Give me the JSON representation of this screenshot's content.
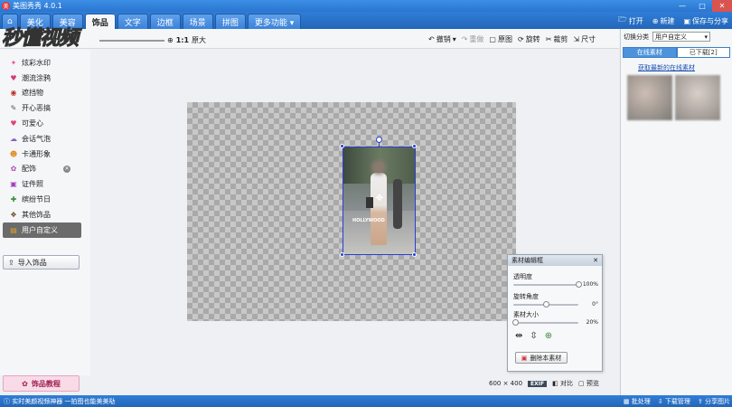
{
  "window": {
    "title": "美图秀秀 4.0.1",
    "controls": [
      "—",
      "□",
      "✕"
    ]
  },
  "menu": {
    "tabs": [
      "美化",
      "美容",
      "饰品",
      "文字",
      "边框",
      "场景",
      "拼图",
      "更多功能 ▾"
    ],
    "active": "饰品",
    "right": {
      "open": "打开",
      "new": "新建",
      "save": "保存与分享"
    }
  },
  "watermark": "秒懂视频",
  "toolbar": {
    "zoom_ratio": "1:1",
    "original_size": "原大",
    "undo": "撤销",
    "redo": "重做",
    "original": "原图",
    "rotate": "旋转",
    "crop": "裁剪",
    "size": "尺寸"
  },
  "sidebar": {
    "items": [
      {
        "icon": "✦",
        "label": "炫彩水印",
        "color": "#e05a9c"
      },
      {
        "icon": "♥",
        "label": "潮流涂鸦",
        "color": "#d33b77"
      },
      {
        "icon": "◉",
        "label": "遮挡物",
        "color": "#c0302a"
      },
      {
        "icon": "✎",
        "label": "开心恶搞",
        "color": "#555555"
      },
      {
        "icon": "♥",
        "label": "可爱心",
        "color": "#e0407a"
      },
      {
        "icon": "☁",
        "label": "会话气泡",
        "color": "#8a60c0"
      },
      {
        "icon": "☻",
        "label": "卡通形象",
        "color": "#e08a20"
      },
      {
        "icon": "✿",
        "label": "配饰",
        "color": "#b050b0"
      },
      {
        "icon": "▣",
        "label": "证件照",
        "color": "#a040c0"
      },
      {
        "icon": "✚",
        "label": "缤纷节日",
        "color": "#3a8a3a"
      },
      {
        "icon": "❖",
        "label": "其他饰品",
        "color": "#6a4a20"
      },
      {
        "icon": "▤",
        "label": "用户自定义",
        "color": "#e0a020"
      }
    ],
    "active_index": 11,
    "import_button": "导入饰品",
    "tutorial": "饰品教程"
  },
  "canvas": {
    "photo_text": "HOLLYWOOD"
  },
  "editor": {
    "title": "素材编辑框",
    "opacity_label": "透明度",
    "opacity_value": "100%",
    "opacity": 1.0,
    "rotation_label": "旋转角度",
    "rotation_value": "0°",
    "rotation": 0.5,
    "size_label": "素材大小",
    "size_value": "20%",
    "size": 0.04,
    "delete_button": "删除本素材"
  },
  "status": {
    "dimensions": "600 × 400",
    "exif": "EXIF",
    "compare": "对比",
    "preview": "预览"
  },
  "rightpanel": {
    "switch_label": "切换分类",
    "category": "用户自定义",
    "tab_online": "在线素材",
    "tab_downloaded": "已下载[2]",
    "link": "获取最新的在线素材"
  },
  "statusbar": {
    "tip": "实时美颜视频神器 一拍图也能美美哒",
    "batch": "批处理",
    "downloads": "下载管理",
    "share": "分享图片"
  }
}
